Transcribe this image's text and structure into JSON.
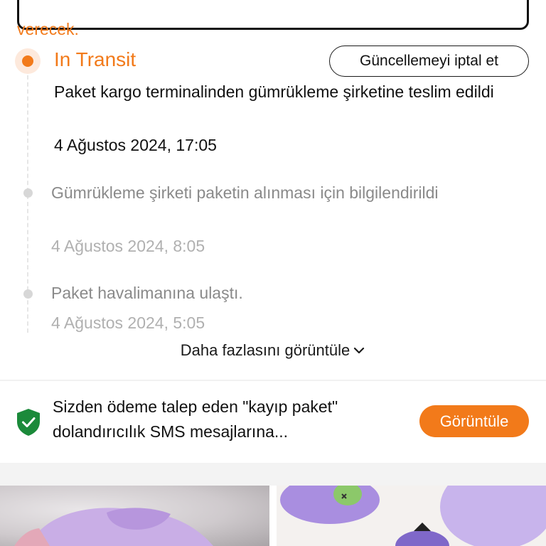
{
  "notice": {
    "text": "verecek."
  },
  "tracking": {
    "current": {
      "status": "In Transit",
      "description": "Paket kargo terminalinden gümrükleme şirketine teslim edildi",
      "date": "4 Ağustos 2024, 17:05"
    },
    "cancel_update_label": "Güncellemeyi iptal et",
    "events": [
      {
        "description": "Gümrükleme şirketi paketin alınması için bilgilendirildi",
        "date": "4 Ağustos 2024, 8:05"
      },
      {
        "description": "Paket havalimanına ulaştı.",
        "date": "4 Ağustos 2024, 5:05"
      }
    ],
    "show_more_label": "Daha fazlasını görüntüle"
  },
  "security_banner": {
    "text": "Sizden ödeme talep eden \"kayıp paket\" dolandırıcılık SMS mesajlarına...",
    "button_label": "Görüntüle",
    "icon": "shield-check-icon"
  },
  "colors": {
    "accent": "#f27a1a",
    "security_green": "#1b8a3a"
  }
}
